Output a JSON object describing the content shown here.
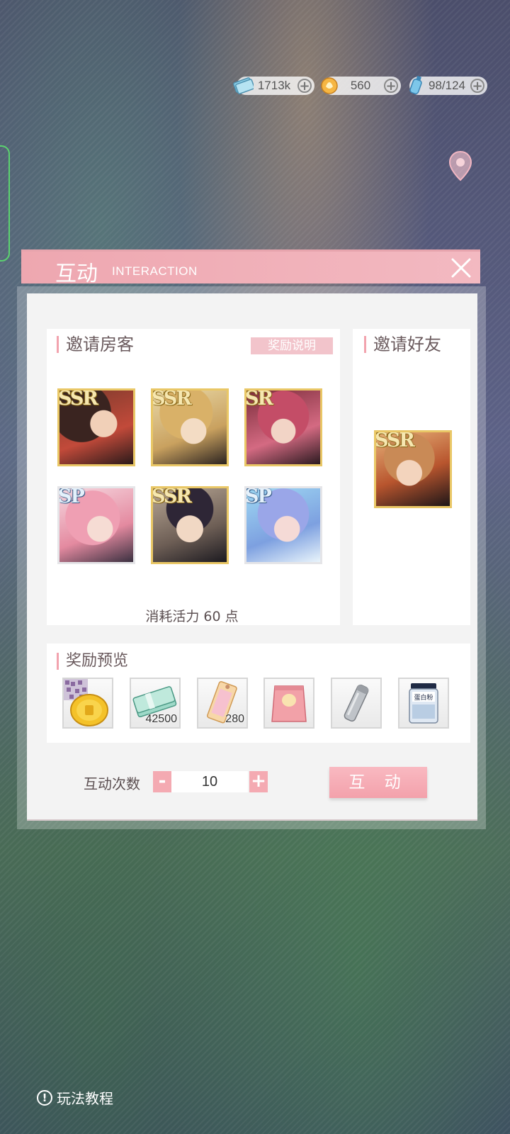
{
  "currency": [
    {
      "icon": "cash-icon",
      "value": "1713k"
    },
    {
      "icon": "gem-icon",
      "value": "560"
    },
    {
      "icon": "stamina-bottle-icon",
      "value": "98/124"
    }
  ],
  "dialog": {
    "title": "互动",
    "subtitle": "INTERACTION",
    "invite_guests": {
      "title": "邀请房客",
      "reward_info_label": "奖励说明",
      "characters": [
        {
          "rarity": "SSR",
          "color": "#7a3a2c"
        },
        {
          "rarity": "SSR",
          "color": "#d8b56c"
        },
        {
          "rarity": "SR",
          "color": "#c45068"
        },
        {
          "rarity": "SP",
          "color": "#e48aa0"
        },
        {
          "rarity": "SSR",
          "color": "#4b4456"
        },
        {
          "rarity": "SP",
          "color": "#8ea2e4"
        }
      ],
      "cost_text": "消耗活力 60 点"
    },
    "invite_friends": {
      "title": "邀请好友",
      "characters": [
        {
          "rarity": "SSR",
          "color": "#c98a56"
        }
      ]
    },
    "reward_preview": {
      "title": "奖励预览",
      "items": [
        {
          "icon": "gold-coin-icon",
          "qty": ""
        },
        {
          "icon": "cash-stack-icon",
          "qty": "42500"
        },
        {
          "icon": "bookmark-ticket-icon",
          "qty": "280"
        },
        {
          "icon": "cat-food-bag-icon",
          "qty": ""
        },
        {
          "icon": "thermos-bottle-icon",
          "qty": ""
        },
        {
          "icon": "protein-powder-jar-icon",
          "qty": ""
        }
      ],
      "jar_label": "蛋白粉"
    },
    "interaction_count": {
      "label": "互动次数",
      "minus": "-",
      "value": "10",
      "plus": "+"
    },
    "action_label": "互 动"
  },
  "tutorial_label": "玩法教程"
}
